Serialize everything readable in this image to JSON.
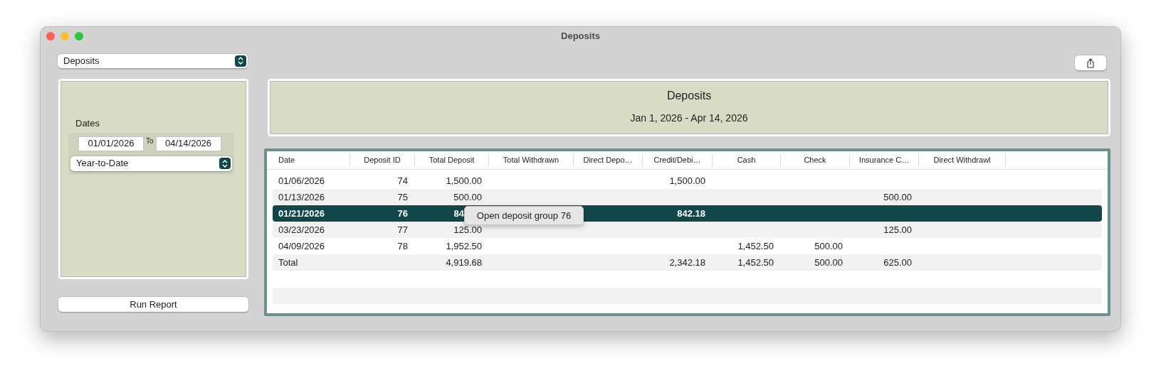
{
  "window": {
    "title": "Deposits"
  },
  "report_picker": {
    "value": "Deposits"
  },
  "filters": {
    "label": "Dates",
    "from": "01/01/2026",
    "to_label": "To",
    "to": "04/14/2026",
    "range": "Year-to-Date"
  },
  "run_button": "Run Report",
  "report_header": {
    "title": "Deposits",
    "subtitle": "Jan 1, 2026 - Apr 14, 2026"
  },
  "table": {
    "columns": [
      "Date",
      "Deposit ID",
      "Total Deposit",
      "Total Withdrawn",
      "Direct Depo…",
      "Credit/Debi…",
      "Cash",
      "Check",
      "Insurance C…",
      "Direct Withdrawl"
    ],
    "rows": [
      {
        "selected": false,
        "cells": [
          "01/06/2026",
          "74",
          "1,500.00",
          null,
          null,
          "1,500.00",
          null,
          null,
          null,
          null
        ]
      },
      {
        "selected": false,
        "cells": [
          "01/13/2026",
          "75",
          "500.00",
          null,
          null,
          null,
          null,
          null,
          "500.00",
          null
        ]
      },
      {
        "selected": true,
        "tooltip": "Open deposit group 76",
        "cells": [
          "01/21/2026",
          "76",
          "84",
          null,
          null,
          "842.18",
          null,
          null,
          null,
          null
        ]
      },
      {
        "selected": false,
        "cells": [
          "03/23/2026",
          "77",
          "125.00",
          null,
          null,
          null,
          null,
          null,
          "125.00",
          null
        ]
      },
      {
        "selected": false,
        "cells": [
          "04/09/2026",
          "78",
          "1,952.50",
          null,
          null,
          null,
          "1,452.50",
          "500.00",
          null,
          null
        ]
      },
      {
        "selected": false,
        "cells": [
          "Total",
          null,
          "4,919.68",
          null,
          null,
          "2,342.18",
          "1,452.50",
          "500.00",
          "625.00",
          null
        ]
      }
    ]
  }
}
